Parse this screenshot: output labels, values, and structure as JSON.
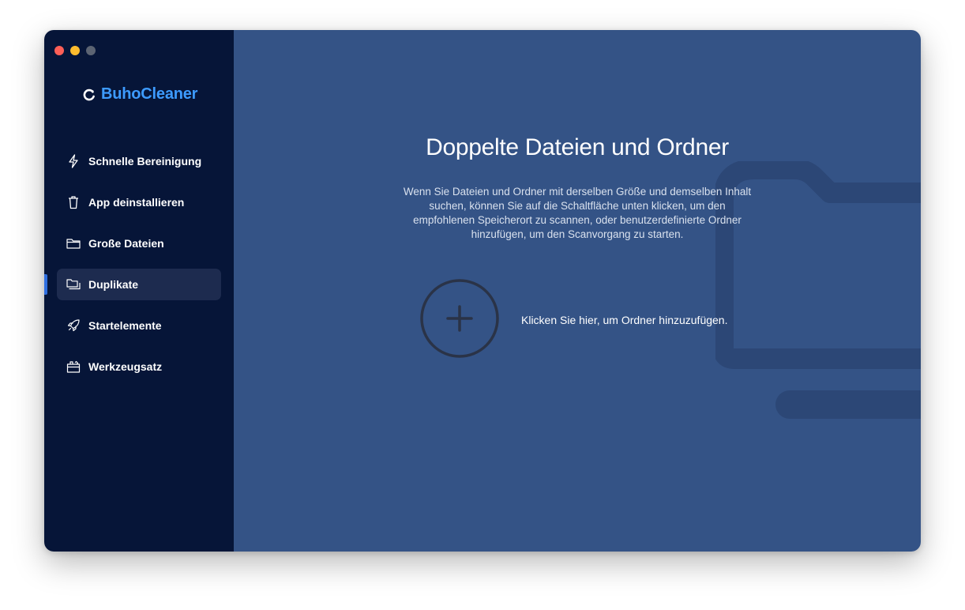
{
  "app": {
    "brand": "BuhoCleaner",
    "brand_color": "#3d9bff"
  },
  "window_controls": [
    "close",
    "minimize",
    "zoom-disabled"
  ],
  "sidebar": {
    "items": [
      {
        "label": "Schnelle Bereinigung",
        "icon": "lightning-icon",
        "active": false
      },
      {
        "label": "App deinstallieren",
        "icon": "trash-icon",
        "active": false
      },
      {
        "label": "Große Dateien",
        "icon": "folder-icon",
        "active": false
      },
      {
        "label": "Duplikate",
        "icon": "duplicate-folders-icon",
        "active": true
      },
      {
        "label": "Startelemente",
        "icon": "rocket-icon",
        "active": false
      },
      {
        "label": "Werkzeugsatz",
        "icon": "toolbox-icon",
        "active": false
      }
    ]
  },
  "main": {
    "title": "Doppelte Dateien und Ordner",
    "description": "Wenn Sie Dateien und Ordner mit derselben Größe und demselben Inhalt suchen, können Sie auf die Schaltfläche unten klicken, um den empfohlenen Speicherort zu scannen, oder benutzerdefinierte Ordner hinzufügen, um den Scanvorgang zu starten.",
    "add_folder_label": "Klicken Sie hier, um Ordner hinzuzufügen."
  },
  "colors": {
    "sidebar_bg": "#061538",
    "main_bg": "#345386",
    "active_item_bg": "#1d2b4f"
  }
}
